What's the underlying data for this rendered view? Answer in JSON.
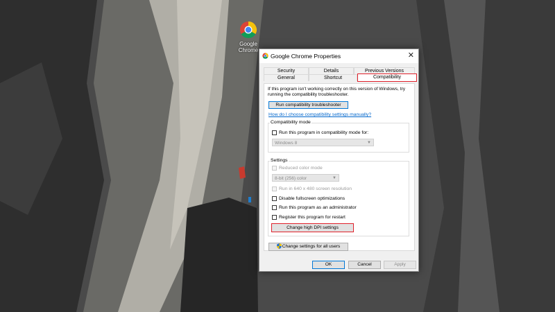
{
  "desktop": {
    "icon_label": "Google Chrome"
  },
  "dialog": {
    "title": "Google Chrome Properties",
    "close_glyph": "✕",
    "tabs_row1": [
      "Security",
      "Details",
      "Previous Versions"
    ],
    "tabs_row2": [
      "General",
      "Shortcut",
      "Compatibility"
    ],
    "active_tab": "Compatibility",
    "intro": "If this program isn't working correctly on this version of Windows, try running the compatibility troubleshooter.",
    "troubleshooter_button": "Run compatibility troubleshooter",
    "help_link": "How do I choose compatibility settings manually?",
    "compat_mode": {
      "group_label": "Compatibility mode",
      "checkbox_label": "Run this program in compatibility mode for:",
      "checked": false,
      "select_value": "Windows 8"
    },
    "settings": {
      "group_label": "Settings",
      "reduced_color_label": "Reduced color mode",
      "color_select_value": "8-bit (256) color",
      "resolution_label": "Run in 640 x 480 screen resolution",
      "fullscreen_label": "Disable fullscreen optimizations",
      "admin_label": "Run this program as an administrator",
      "restart_label": "Register this program for restart",
      "dpi_button": "Change high DPI settings"
    },
    "all_users_button": "Change settings for all users",
    "footer": {
      "ok": "OK",
      "cancel": "Cancel",
      "apply": "Apply"
    }
  },
  "colors": {
    "highlight": "#e0202a",
    "link": "#0066cc",
    "dialog_bg": "#f0f0f0"
  }
}
